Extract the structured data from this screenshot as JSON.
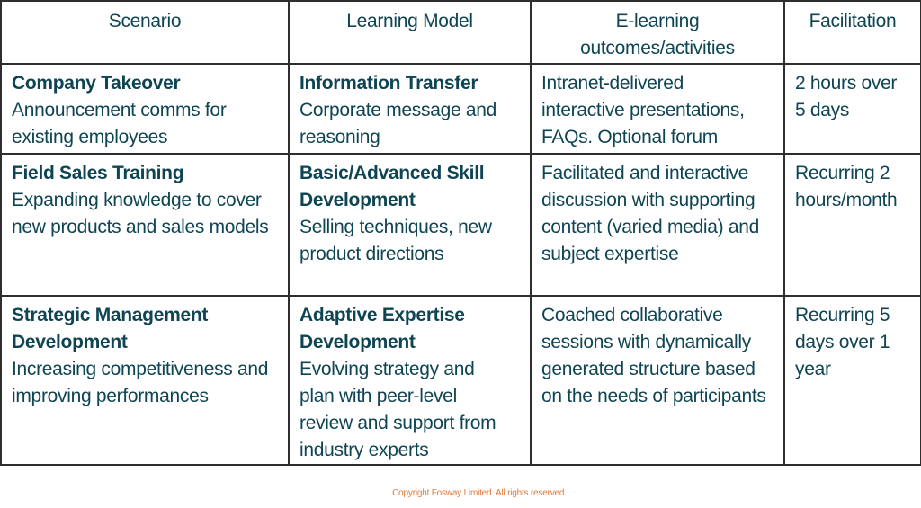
{
  "table": {
    "headers": [
      {
        "lines": [
          "Scenario"
        ]
      },
      {
        "lines": [
          "Learning Model"
        ]
      },
      {
        "lines": [
          "E-learning",
          "outcomes/activities"
        ]
      },
      {
        "lines": [
          "Facilitation"
        ]
      }
    ],
    "rows": [
      {
        "scenario": {
          "title": [
            "Company Takeover"
          ],
          "desc": [
            "Announcement comms for",
            "existing employees"
          ]
        },
        "model": {
          "title": [
            "Information Transfer"
          ],
          "desc": [
            "Corporate message and",
            "reasoning"
          ]
        },
        "activities": {
          "desc": [
            "Intranet-delivered",
            "interactive presentations,",
            "FAQs. Optional forum"
          ]
        },
        "facilitation": {
          "desc": [
            "2 hours over",
            "5 days"
          ]
        }
      },
      {
        "scenario": {
          "title": [
            "Field Sales Training"
          ],
          "desc": [
            "Expanding knowledge to cover",
            "new products and sales models"
          ]
        },
        "model": {
          "title": [
            "Basic/Advanced Skill",
            "Development"
          ],
          "desc": [
            "Selling techniques, new",
            "product directions"
          ]
        },
        "activities": {
          "desc": [
            "Facilitated and interactive",
            "discussion with supporting",
            "content (varied media) and",
            "subject expertise"
          ]
        },
        "facilitation": {
          "desc": [
            "Recurring 2",
            "hours/month"
          ]
        }
      },
      {
        "scenario": {
          "title": [
            "Strategic Management",
            "Development"
          ],
          "desc": [
            "Increasing competitiveness and",
            "improving performances"
          ]
        },
        "model": {
          "title": [
            "Adaptive Expertise",
            "Development"
          ],
          "desc": [
            "Evolving strategy and",
            "plan with peer-level",
            "review and support from",
            "industry experts"
          ]
        },
        "activities": {
          "desc": [
            "Coached collaborative",
            "sessions with dynamically",
            "generated structure based",
            "on the needs of participants"
          ]
        },
        "facilitation": {
          "desc": [
            "Recurring 5",
            "days over 1",
            "year"
          ]
        }
      }
    ]
  },
  "footer": {
    "copyright": "Copyright Fosway Limited. All rights reserved."
  },
  "colors": {
    "text": "#0f4553",
    "border": "#2e2e2e",
    "copyright": "#e07a3a"
  }
}
